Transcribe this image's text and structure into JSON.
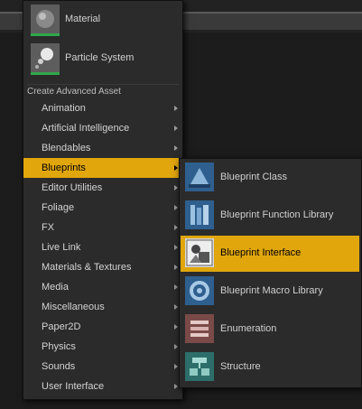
{
  "assets": [
    {
      "label": "Material",
      "icon": "material-icon"
    },
    {
      "label": "Particle System",
      "icon": "particle-system-icon"
    }
  ],
  "section_header": "Create Advanced Asset",
  "categories": [
    {
      "label": "Animation"
    },
    {
      "label": "Artificial Intelligence"
    },
    {
      "label": "Blendables"
    },
    {
      "label": "Blueprints",
      "active": true
    },
    {
      "label": "Editor Utilities"
    },
    {
      "label": "Foliage"
    },
    {
      "label": "FX"
    },
    {
      "label": "Live Link"
    },
    {
      "label": "Materials & Textures"
    },
    {
      "label": "Media"
    },
    {
      "label": "Miscellaneous"
    },
    {
      "label": "Paper2D"
    },
    {
      "label": "Physics"
    },
    {
      "label": "Sounds"
    },
    {
      "label": "User Interface"
    }
  ],
  "blueprints_submenu": [
    {
      "label": "Blueprint Class",
      "icon": "blueprint-class-icon"
    },
    {
      "label": "Blueprint Function Library",
      "icon": "blueprint-function-library-icon"
    },
    {
      "label": "Blueprint Interface",
      "icon": "blueprint-interface-icon",
      "active": true
    },
    {
      "label": "Blueprint Macro Library",
      "icon": "blueprint-macro-library-icon"
    },
    {
      "label": "Enumeration",
      "icon": "enumeration-icon"
    },
    {
      "label": "Structure",
      "icon": "structure-icon"
    }
  ],
  "colors": {
    "highlight": "#e0a60c",
    "menu_bg": "#2b2b2b",
    "asset_accent": "#2fa84a"
  }
}
